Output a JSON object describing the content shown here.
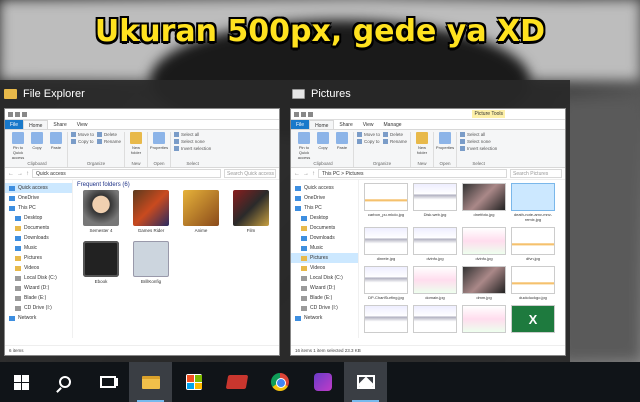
{
  "headline": "Ukuran 500px, gede ya XD",
  "left_window": {
    "title": "File Explorer",
    "tabs": [
      "File",
      "Home",
      "Share",
      "View"
    ],
    "ribbon": {
      "clipboard": {
        "pin": "Pin to Quick access",
        "copy": "Copy",
        "paste": "Paste",
        "label": "Clipboard"
      },
      "organize": {
        "move_to": "Move to",
        "copy_to": "Copy to",
        "delete": "Delete",
        "rename": "Rename",
        "label": "Organize"
      },
      "new": {
        "new_folder": "New folder",
        "label": "New"
      },
      "open": {
        "properties": "Properties",
        "label": "Open"
      },
      "select": {
        "select_all": "Select all",
        "select_none": "Select none",
        "invert": "Invert selection",
        "label": "Select"
      }
    },
    "address": "Quick access",
    "search_placeholder": "Search Quick access",
    "nav": [
      "Quick access",
      "OneDrive",
      "This PC",
      "Desktop",
      "Documents",
      "Downloads",
      "Music",
      "Pictures",
      "Videos",
      "Local Disk (C:)",
      "Wizard (D:)",
      "Blade (E:)",
      "CD Drive (I:)",
      "Network"
    ],
    "section_title": "Frequent folders (6)",
    "folders": [
      "Semester 4",
      "Games Rider",
      "Anime",
      "Film",
      "Ebook",
      "BrillKonfig"
    ],
    "status": "6 items"
  },
  "right_window": {
    "title": "Pictures",
    "tabs": [
      "File",
      "Home",
      "Share",
      "View",
      "Manage"
    ],
    "tool_tab": "Picture Tools",
    "ribbon": {
      "clipboard": {
        "pin": "Pin to Quick access",
        "copy": "Copy",
        "paste": "Paste",
        "label": "Clipboard"
      },
      "organize": {
        "move_to": "Move to",
        "copy_to": "Copy to",
        "delete": "Delete",
        "rename": "Rename",
        "label": "Organize"
      },
      "new": {
        "new_folder": "New folder",
        "label": "New"
      },
      "open": {
        "properties": "Properties",
        "label": "Open"
      },
      "select": {
        "select_all": "Select all",
        "select_none": "Select none",
        "invert": "Invert selection",
        "label": "Select"
      }
    },
    "address": "This PC  >  Pictures",
    "search_placeholder": "Search Pictures",
    "nav": [
      "Quick access",
      "OneDrive",
      "This PC",
      "Desktop",
      "Documents",
      "Downloads",
      "Music",
      "Pictures",
      "Videos",
      "Local Disk (C:)",
      "Wizard (D:)",
      "Blade (E:)",
      "CD Drive (I:)",
      "Network"
    ],
    "files": [
      "carbon_pu.mkdo.jpg",
      "Disk.web.jpg",
      "dnetfoto.jpg",
      "death-note-amv-mnv-remix.jpg",
      "dinrele.jpg",
      "dvinfo.jpg",
      "dvinfo.jpg",
      "dfvn.jpg",
      "DP-ChartSurfing.jpg",
      "domain.jpg",
      "dmm.jpg",
      "duckduckgo.jpg",
      "",
      "",
      "",
      ""
    ],
    "status": "16 items   1 item selected  23.3 KB"
  }
}
